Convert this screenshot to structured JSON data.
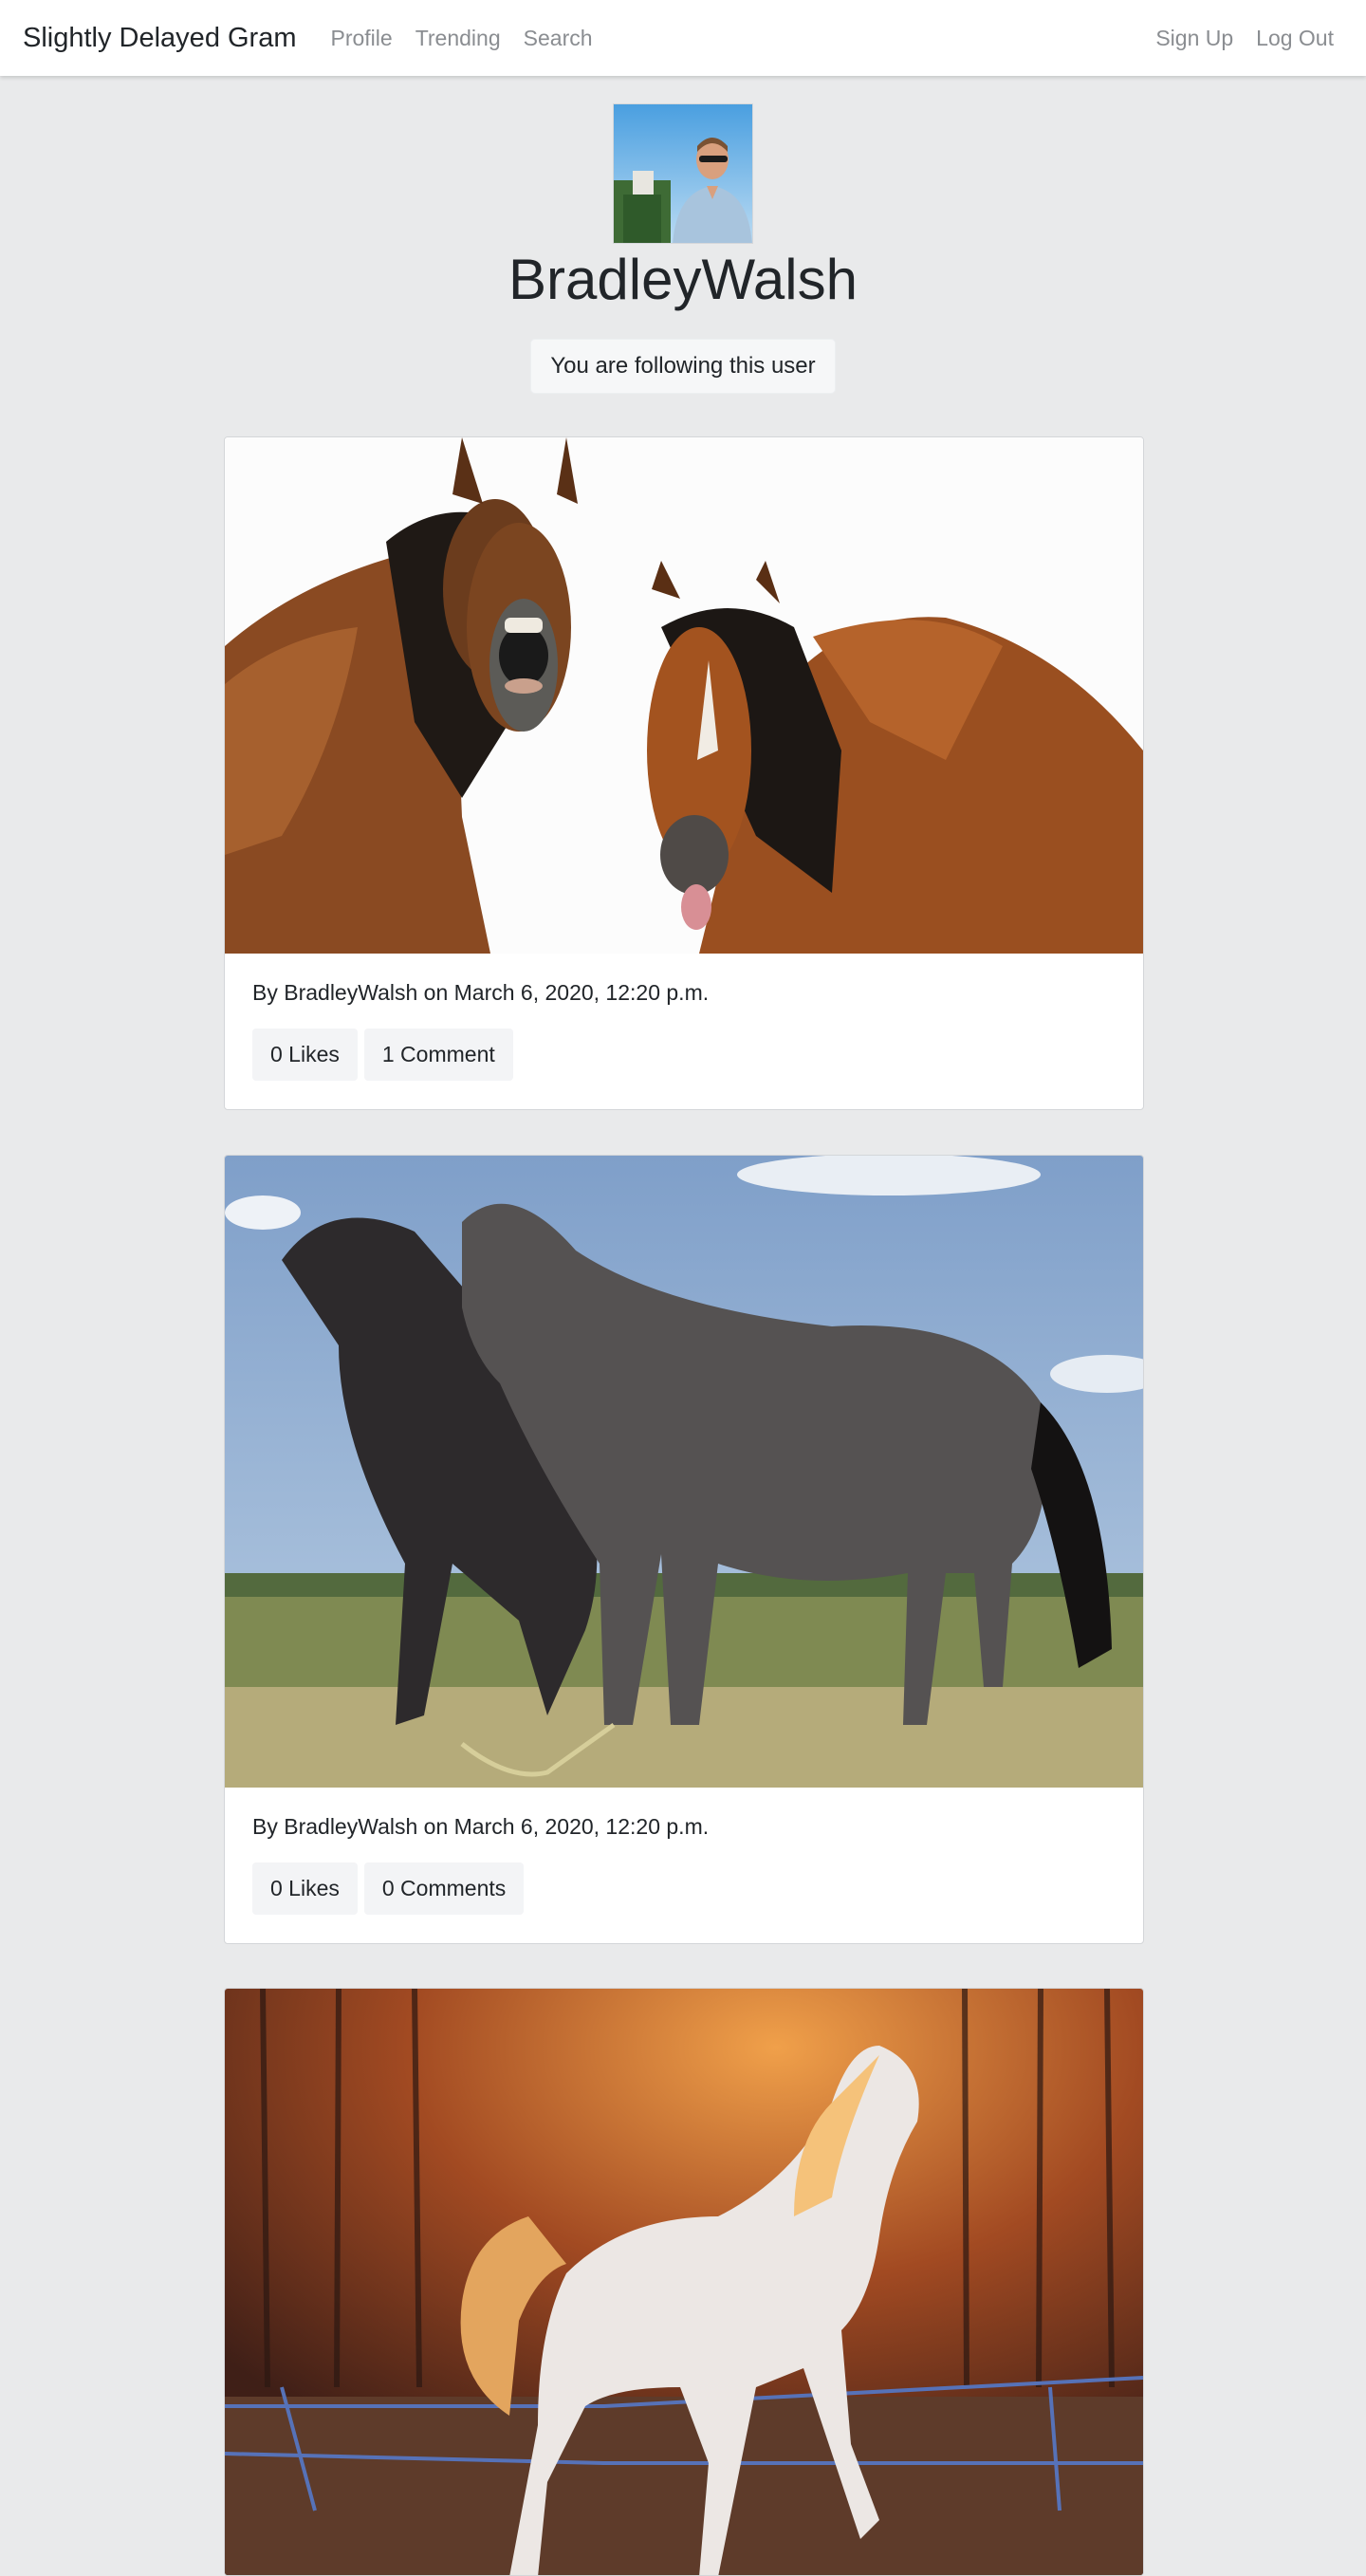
{
  "navbar": {
    "brand": "Slightly Delayed Gram",
    "links": [
      "Profile",
      "Trending",
      "Search"
    ],
    "right_links": [
      "Sign Up",
      "Log Out"
    ]
  },
  "profile": {
    "username": "BradleyWalsh",
    "follow_status": "You are following this user",
    "avatar_icon": "user-avatar-photo"
  },
  "posts": [
    {
      "image": "two-bay-horses-laughing-photo",
      "byline": "By BradleyWalsh on March 6, 2020, 12:20 p.m.",
      "likes": "0 Likes",
      "comments": "1 Comment"
    },
    {
      "image": "two-grey-horses-in-field-photo",
      "byline": "By BradleyWalsh on March 6, 2020, 12:20 p.m.",
      "likes": "0 Likes",
      "comments": "0 Comments"
    },
    {
      "image": "white-horse-galloping-sunset-photo"
    }
  ]
}
